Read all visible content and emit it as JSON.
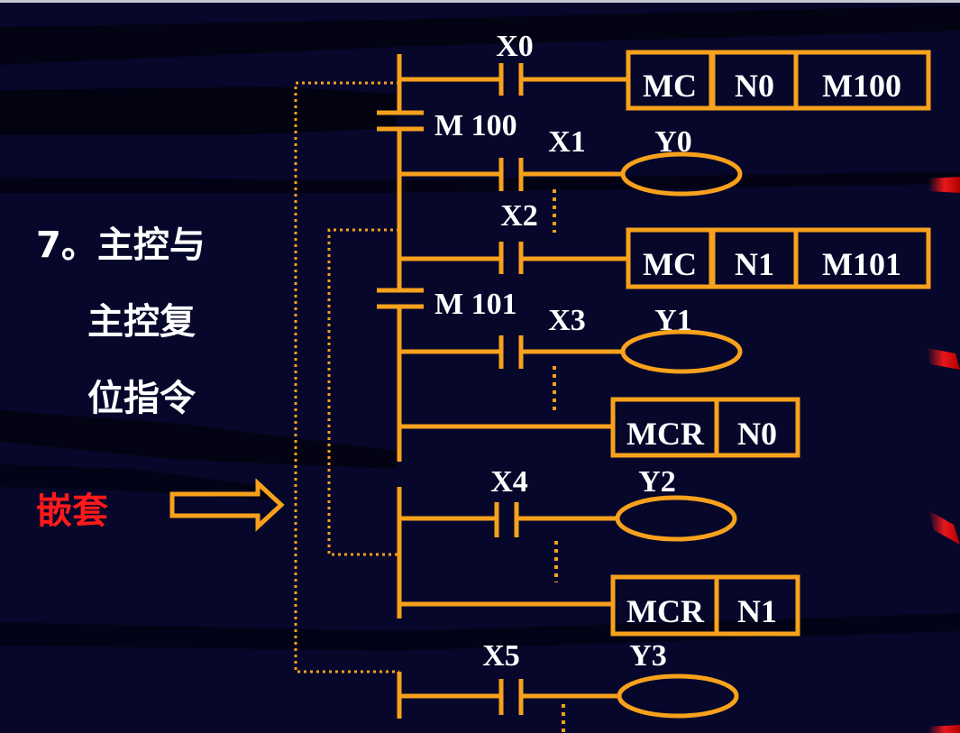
{
  "slide": {
    "title_lines": [
      "7。主控与",
      "主控复",
      "位指令"
    ],
    "highlight": "嵌套"
  },
  "ladder": {
    "master_contacts": [
      "M 100",
      "M 101"
    ],
    "contacts": [
      "X0",
      "X1",
      "X2",
      "X3",
      "X4",
      "X5"
    ],
    "coils": [
      "Y0",
      "Y1",
      "Y2",
      "Y3"
    ],
    "instructions": [
      {
        "op": "MC",
        "n": "N0",
        "device": "M100"
      },
      {
        "op": "MC",
        "n": "N1",
        "device": "M101"
      },
      {
        "op": "MCR",
        "n": "N0"
      },
      {
        "op": "MCR",
        "n": "N1"
      }
    ]
  },
  "icons": {
    "nesting_arrow": "hollow-right-arrow-icon"
  },
  "colors": {
    "background": "#07072b",
    "ladder": "#f7a11c",
    "text": "#ffffff",
    "accent": "#ff1a1a"
  }
}
